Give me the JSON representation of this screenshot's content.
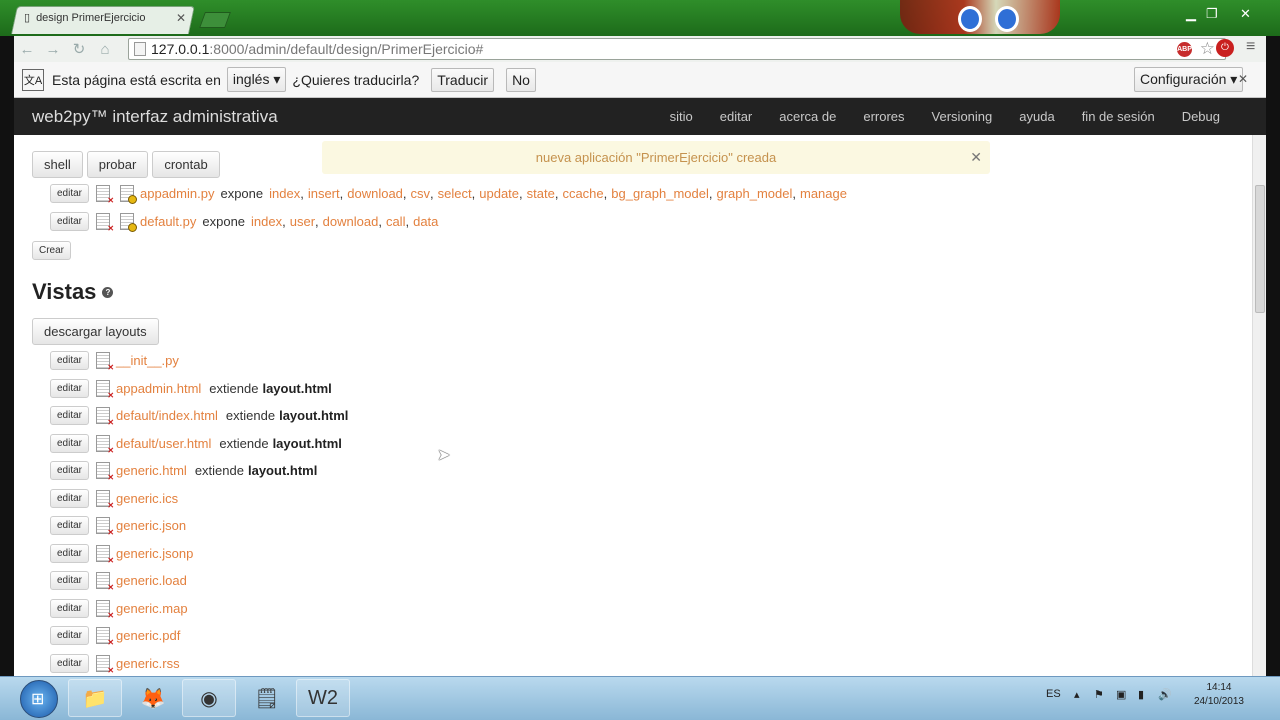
{
  "browser": {
    "tab_title": "design PrimerEjercicio",
    "url_host": "127.0.0.1",
    "url_path": ":8000/admin/default/design/PrimerEjercicio#"
  },
  "translate_bar": {
    "text_before": "Esta página está escrita en",
    "language": "inglés",
    "question": "¿Quieres traducirla?",
    "translate_label": "Traducir",
    "no_label": "No",
    "config_label": "Configuración"
  },
  "nav": {
    "brand": "web2py™ interfaz administrativa",
    "items": [
      "sitio",
      "editar",
      "acerca de",
      "errores",
      "Versioning",
      "ayuda",
      "fin de sesión",
      "Debug"
    ]
  },
  "toolbar_buttons": [
    "shell",
    "probar",
    "crontab"
  ],
  "flash": "nueva aplicación \"PrimerEjercicio\" creada",
  "controllers": [
    {
      "file": "appadmin.py",
      "exposes": [
        "index",
        "insert",
        "download",
        "csv",
        "select",
        "update",
        "state",
        "ccache",
        "bg_graph_model",
        "graph_model",
        "manage"
      ]
    },
    {
      "file": "default.py",
      "exposes": [
        "index",
        "user",
        "download",
        "call",
        "data"
      ]
    }
  ],
  "labels": {
    "edit": "editar",
    "expose": "expone",
    "create": "Crear",
    "views_title": "Vistas",
    "download_layouts": "descargar layouts",
    "extends": "extiende"
  },
  "views": [
    {
      "file": "__init__.py",
      "extends": ""
    },
    {
      "file": "appadmin.html",
      "extends": "layout.html"
    },
    {
      "file": "default/index.html",
      "extends": "layout.html"
    },
    {
      "file": "default/user.html",
      "extends": "layout.html"
    },
    {
      "file": "generic.html",
      "extends": "layout.html"
    },
    {
      "file": "generic.ics",
      "extends": ""
    },
    {
      "file": "generic.json",
      "extends": ""
    },
    {
      "file": "generic.jsonp",
      "extends": ""
    },
    {
      "file": "generic.load",
      "extends": ""
    },
    {
      "file": "generic.map",
      "extends": ""
    },
    {
      "file": "generic.pdf",
      "extends": ""
    },
    {
      "file": "generic.rss",
      "extends": ""
    }
  ],
  "taskbar": {
    "lang": "ES",
    "time": "14:14",
    "date": "24/10/2013"
  }
}
